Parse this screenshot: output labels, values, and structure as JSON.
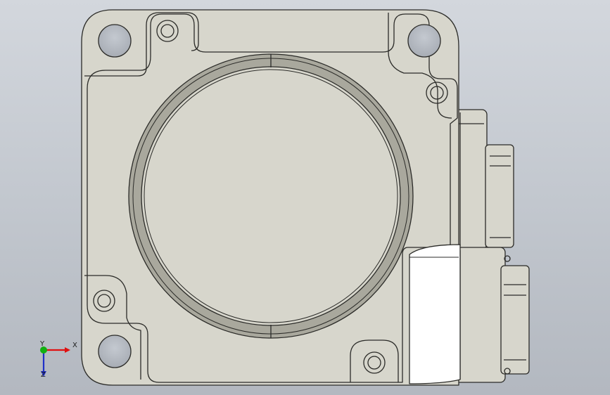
{
  "viewport": {
    "background_top": "#d3d7dd",
    "background_bottom": "#b3b8c0"
  },
  "model": {
    "part_fill": "#d7d6cc",
    "edge_color": "#2b2b28",
    "bore_ring_color": "#a9a89d",
    "highlight_face_color": "#ffffff",
    "hole_color": "#a7adb6",
    "icon": "motor-flange-part-icon"
  },
  "triad": {
    "x_label": "X",
    "y_label": "Y",
    "z_label": "Z",
    "x_color": "#e01010",
    "y_color": "#11b011",
    "z_color": "#2030c8"
  }
}
